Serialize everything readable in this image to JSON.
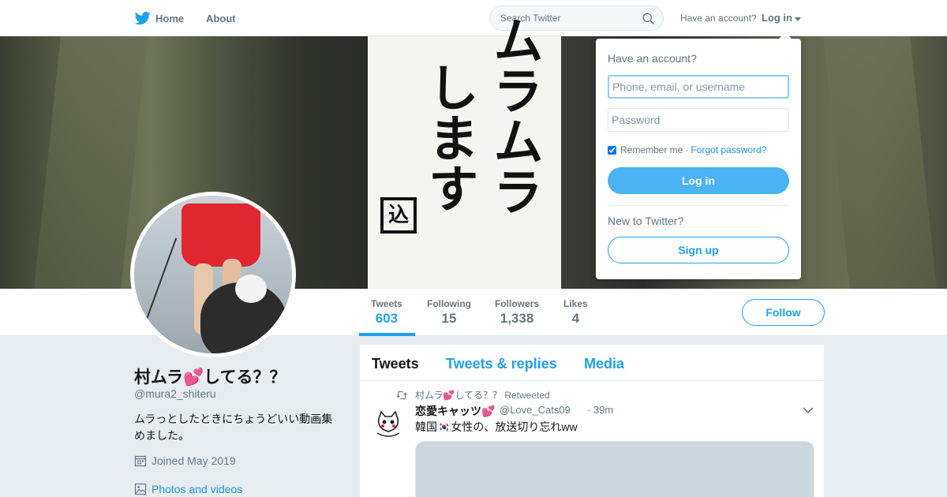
{
  "nav": {
    "home_label": "Home",
    "about_label": "About",
    "search_placeholder": "Search Twitter",
    "have_account": "Have an account?",
    "login_label": "Log in"
  },
  "banner": {
    "sign_col1": "ムラムラ",
    "sign_col2": "します",
    "stamp": "込"
  },
  "profile": {
    "name": "村ムラ💕してる？？",
    "handle": "@mura2_shiteru",
    "bio": "ムラっとしたときにちょうどいい動画集めました。",
    "joined": "Joined May 2019",
    "photos_link": "Photos and videos"
  },
  "stats": [
    {
      "label": "Tweets",
      "value": "603"
    },
    {
      "label": "Following",
      "value": "15"
    },
    {
      "label": "Followers",
      "value": "1,338"
    },
    {
      "label": "Likes",
      "value": "4"
    }
  ],
  "follow_label": "Follow",
  "timeline": {
    "tabs": [
      "Tweets",
      "Tweets & replies",
      "Media"
    ],
    "tweet": {
      "retweeted_by": "村ムラ💕してる？？ Retweeted",
      "author": "恋愛キャッツ💕",
      "handle": "@Love_Cats09",
      "time": "· 39m",
      "text": "韓国🇰🇷女性の、放送切り忘れww"
    }
  },
  "login_dropdown": {
    "title": "Have an account?",
    "username_placeholder": "Phone, email, or username",
    "password_placeholder": "Password",
    "remember": "Remember me",
    "separator": "·",
    "forgot": "Forgot password?",
    "login_button": "Log in",
    "new_to_twitter": "New to Twitter?",
    "signup_button": "Sign up"
  },
  "colors": {
    "brand_blue": "#1da1f2",
    "link_blue": "#1b95e0",
    "login_button": "#4ab3f4",
    "background": "#e6ecf0"
  },
  "icons": [
    "twitter-bird-icon",
    "search-icon",
    "caret-down-icon",
    "calendar-icon",
    "photo-icon",
    "retweet-icon",
    "chevron-down-icon"
  ]
}
